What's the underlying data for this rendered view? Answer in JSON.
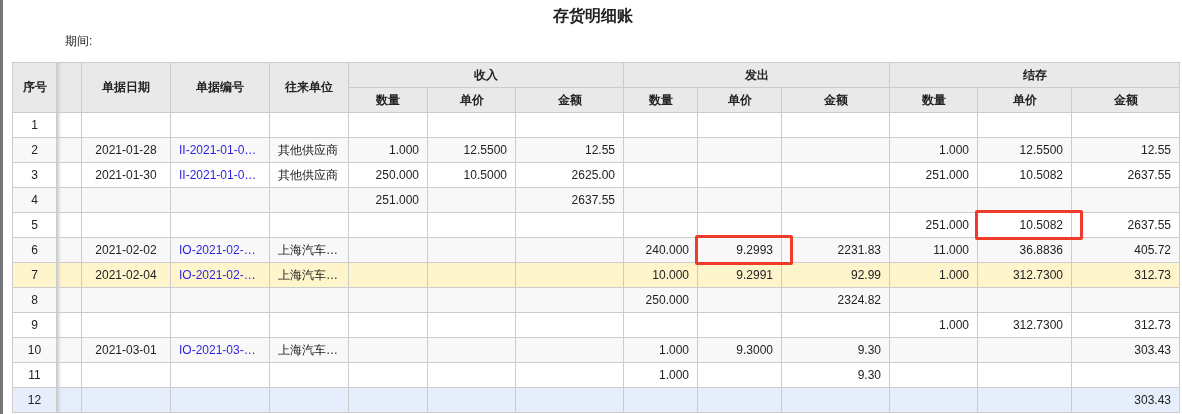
{
  "title": "存货明细账",
  "period_label": "期间:",
  "columns": [
    "序号",
    "单据日期",
    "单据编号",
    "往来单位"
  ],
  "groups": [
    {
      "label": "收入",
      "columns": [
        "数量",
        "单价",
        "金额"
      ]
    },
    {
      "label": "发出",
      "columns": [
        "数量",
        "单价",
        "金额"
      ]
    },
    {
      "label": "结存",
      "columns": [
        "数量",
        "单价",
        "金额"
      ]
    }
  ],
  "rows": [
    {
      "seq": "1",
      "selected": false,
      "hovered": false
    },
    {
      "seq": "2",
      "date": "2021-01-28",
      "doc_no": "II-2021-01-0…",
      "partner": "其他供应商",
      "received": {
        "qty": "1.000",
        "price": "12.5500",
        "amount": "12.55"
      },
      "balance": {
        "qty": "1.000",
        "price": "12.5500",
        "amount": "12.55"
      },
      "selected": false,
      "hovered": false
    },
    {
      "seq": "3",
      "date": "2021-01-30",
      "doc_no": "II-2021-01-0…",
      "partner": "其他供应商",
      "received": {
        "qty": "250.000",
        "price": "10.5000",
        "amount": "2625.00"
      },
      "balance": {
        "qty": "251.000",
        "price": "10.5082",
        "amount": "2637.55"
      },
      "selected": false,
      "hovered": false
    },
    {
      "seq": "4",
      "received": {
        "qty": "251.000",
        "amount": "2637.55"
      },
      "selected": false,
      "hovered": false
    },
    {
      "seq": "5",
      "balance": {
        "qty": "251.000",
        "price": {
          "text": "10.5082",
          "boxed": true
        },
        "amount": "2637.55"
      },
      "selected": false,
      "hovered": false
    },
    {
      "seq": "6",
      "date": "2021-02-02",
      "doc_no": "IO-2021-02-…",
      "partner": "上海汽车…",
      "issued": {
        "qty": "240.000",
        "price": {
          "text": "9.2993",
          "boxed": true
        },
        "amount": "2231.83"
      },
      "balance": {
        "qty": "11.000",
        "price": "36.8836",
        "amount": "405.72"
      },
      "selected": false,
      "hovered": false
    },
    {
      "seq": "7",
      "date": "2021-02-04",
      "doc_no": "IO-2021-02-…",
      "partner": "上海汽车…",
      "issued": {
        "qty": "10.000",
        "price": "9.2991",
        "amount": "92.99"
      },
      "balance": {
        "qty": "1.000",
        "price": "312.7300",
        "amount": "312.73"
      },
      "selected": true,
      "hovered": false
    },
    {
      "seq": "8",
      "issued": {
        "qty": "250.000",
        "amount": "2324.82"
      },
      "selected": false,
      "hovered": false
    },
    {
      "seq": "9",
      "balance": {
        "qty": "1.000",
        "price": "312.7300",
        "amount": "312.73"
      },
      "selected": false,
      "hovered": false
    },
    {
      "seq": "10",
      "date": "2021-03-01",
      "doc_no": "IO-2021-03-…",
      "partner": "上海汽车…",
      "issued": {
        "qty": "1.000",
        "price": "9.3000",
        "amount": "9.30"
      },
      "balance": {
        "amount": "303.43"
      },
      "selected": false,
      "hovered": false
    },
    {
      "seq": "11",
      "issued": {
        "qty": "1.000",
        "amount": "9.30"
      },
      "selected": false,
      "hovered": false
    },
    {
      "seq": "12",
      "balance": {
        "amount": "303.43"
      },
      "selected": false,
      "hovered": true
    }
  ]
}
